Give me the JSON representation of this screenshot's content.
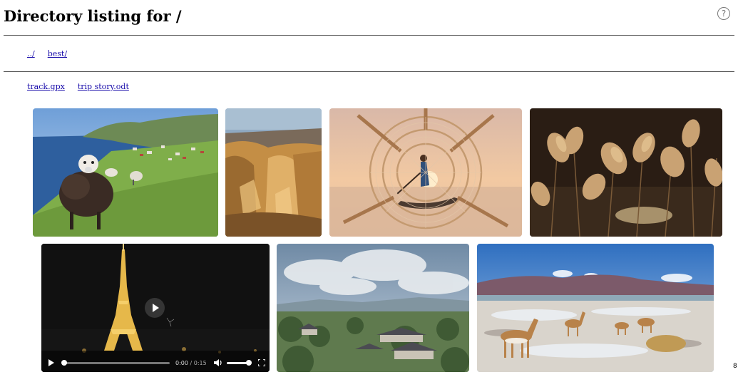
{
  "page": {
    "title": "Directory listing for /",
    "help_label": "?",
    "page_number": "8"
  },
  "directories": [
    {
      "label": "../"
    },
    {
      "label": "best/"
    }
  ],
  "files": [
    {
      "label": "track.gpx"
    },
    {
      "label": "trip story.odt"
    }
  ],
  "gallery": {
    "images": [
      {
        "subject": "sheep on coastal hillside with village"
      },
      {
        "subject": "golden sandstone canyon"
      },
      {
        "subject": "fisherman framed by conical fishing net at sunset"
      },
      {
        "subject": "backlit reeds over water"
      },
      {
        "subject": "cloudy sky over japanese town"
      },
      {
        "subject": "vicunas on salt flat below mountains"
      }
    ],
    "video": {
      "subject": "eiffel tower at night",
      "current_time": "0:00",
      "separator": " / ",
      "duration": "0:15",
      "progress": 0,
      "volume": 1.0
    }
  }
}
